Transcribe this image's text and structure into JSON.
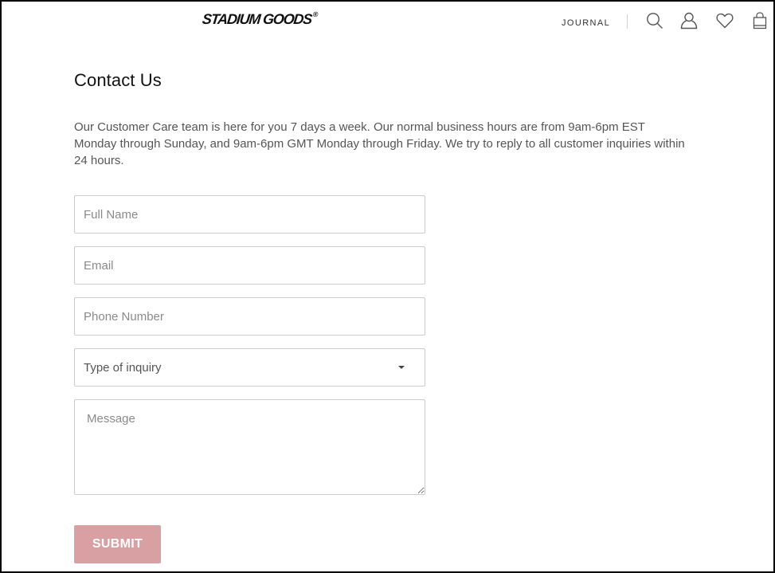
{
  "header": {
    "logo": "STADIUM GOODS",
    "logo_mark": "®",
    "nav_journal": "JOURNAL",
    "icons": [
      "search-icon",
      "account-icon",
      "wishlist-heart-icon",
      "shopping-bag-icon"
    ]
  },
  "page": {
    "title": "Contact Us",
    "intro": "Our Customer Care team is here for you 7 days a week. Our normal business hours are from 9am-6pm EST Monday through Sunday, and 9am-6pm GMT Monday through Friday. We try to reply to all customer inquiries within 24 hours."
  },
  "form": {
    "full_name": {
      "placeholder": "Full Name",
      "value": ""
    },
    "email": {
      "placeholder": "Email",
      "value": ""
    },
    "phone": {
      "placeholder": "Phone Number",
      "value": ""
    },
    "inquiry_type": {
      "selected": "Type of inquiry"
    },
    "message": {
      "placeholder": "Message",
      "value": ""
    },
    "submit_label": "SUBMIT"
  },
  "colors": {
    "submit_bg": "#d9a0a3",
    "text_primary": "#111111",
    "text_body": "#555555",
    "border": "#cccccc"
  }
}
